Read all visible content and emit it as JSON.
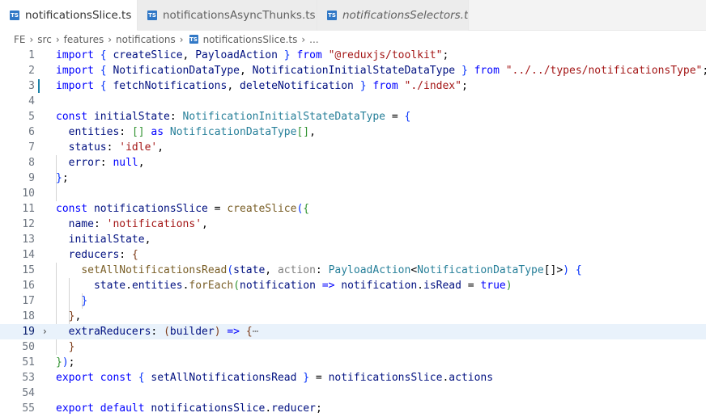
{
  "tabs": [
    {
      "label": "notificationsSlice.ts",
      "icon": "ts-file-icon",
      "active": true,
      "dirty": true,
      "italic": false
    },
    {
      "label": "notificationsAsyncThunks.ts",
      "icon": "ts-file-icon",
      "active": false,
      "dirty": true,
      "italic": false
    },
    {
      "label": "notificationsSelectors.ts",
      "icon": "ts-file-icon",
      "active": false,
      "dirty": false,
      "italic": true
    }
  ],
  "ts_icon_text": "TS",
  "breadcrumb": [
    "FE",
    "src",
    "features",
    "notifications",
    "notificationsSlice.ts",
    "..."
  ],
  "current_line": "19",
  "lines": [
    {
      "n": "1",
      "tokens": [
        [
          "k",
          "import"
        ],
        [
          "p",
          " "
        ],
        [
          "b1",
          "{"
        ],
        [
          "p",
          " "
        ],
        [
          "v",
          "createSlice"
        ],
        [
          "p",
          ", "
        ],
        [
          "v",
          "PayloadAction"
        ],
        [
          "p",
          " "
        ],
        [
          "b1",
          "}"
        ],
        [
          "p",
          " "
        ],
        [
          "k",
          "from"
        ],
        [
          "p",
          " "
        ],
        [
          "s",
          "\"@reduxjs/toolkit\""
        ],
        [
          "p",
          ";"
        ]
      ]
    },
    {
      "n": "2",
      "tokens": [
        [
          "k",
          "import"
        ],
        [
          "p",
          " "
        ],
        [
          "b1",
          "{"
        ],
        [
          "p",
          " "
        ],
        [
          "v",
          "NotificationDataType"
        ],
        [
          "p",
          ", "
        ],
        [
          "v",
          "NotificationInitialStateDataType"
        ],
        [
          "p",
          " "
        ],
        [
          "b1",
          "}"
        ],
        [
          "p",
          " "
        ],
        [
          "k",
          "from"
        ],
        [
          "p",
          " "
        ],
        [
          "s",
          "\"../../types/notificationsType\""
        ],
        [
          "p",
          ";"
        ]
      ]
    },
    {
      "n": "3",
      "tokens": [
        [
          "k",
          "import"
        ],
        [
          "p",
          " "
        ],
        [
          "b1",
          "{"
        ],
        [
          "p",
          " "
        ],
        [
          "v",
          "fetchNotifications"
        ],
        [
          "p",
          ", "
        ],
        [
          "v",
          "deleteNotification"
        ],
        [
          "p",
          " "
        ],
        [
          "b1",
          "}"
        ],
        [
          "p",
          " "
        ],
        [
          "k",
          "from"
        ],
        [
          "p",
          " "
        ],
        [
          "s",
          "\"./index\""
        ],
        [
          "p",
          ";"
        ]
      ]
    },
    {
      "n": "4",
      "tokens": []
    },
    {
      "n": "5",
      "tokens": [
        [
          "k",
          "const"
        ],
        [
          "p",
          " "
        ],
        [
          "v",
          "initialState"
        ],
        [
          "p",
          ": "
        ],
        [
          "t",
          "NotificationInitialStateDataType"
        ],
        [
          "p",
          " = "
        ],
        [
          "b1",
          "{"
        ]
      ]
    },
    {
      "n": "6",
      "tokens": [
        [
          "p",
          "  "
        ],
        [
          "v",
          "entities"
        ],
        [
          "p",
          ": "
        ],
        [
          "b2",
          "[]"
        ],
        [
          "p",
          " "
        ],
        [
          "k",
          "as"
        ],
        [
          "p",
          " "
        ],
        [
          "t",
          "NotificationDataType"
        ],
        [
          "b2",
          "[]"
        ],
        [
          "p",
          ","
        ]
      ]
    },
    {
      "n": "7",
      "tokens": [
        [
          "p",
          "  "
        ],
        [
          "v",
          "status"
        ],
        [
          "p",
          ": "
        ],
        [
          "s",
          "'idle'"
        ],
        [
          "p",
          ","
        ]
      ]
    },
    {
      "n": "8",
      "tokens": [
        [
          "p",
          "  "
        ],
        [
          "v",
          "error"
        ],
        [
          "p",
          ": "
        ],
        [
          "k",
          "null"
        ],
        [
          "p",
          ","
        ]
      ]
    },
    {
      "n": "9",
      "tokens": [
        [
          "b1",
          "}"
        ],
        [
          "p",
          ";"
        ]
      ]
    },
    {
      "n": "10",
      "tokens": []
    },
    {
      "n": "11",
      "tokens": [
        [
          "k",
          "const"
        ],
        [
          "p",
          " "
        ],
        [
          "v",
          "notificationsSlice"
        ],
        [
          "p",
          " = "
        ],
        [
          "f",
          "createSlice"
        ],
        [
          "b1",
          "("
        ],
        [
          "b2",
          "{"
        ]
      ]
    },
    {
      "n": "12",
      "tokens": [
        [
          "p",
          "  "
        ],
        [
          "v",
          "name"
        ],
        [
          "p",
          ": "
        ],
        [
          "s",
          "'notifications'"
        ],
        [
          "p",
          ","
        ]
      ]
    },
    {
      "n": "13",
      "tokens": [
        [
          "p",
          "  "
        ],
        [
          "v",
          "initialState"
        ],
        [
          "p",
          ","
        ]
      ]
    },
    {
      "n": "14",
      "tokens": [
        [
          "p",
          "  "
        ],
        [
          "v",
          "reducers"
        ],
        [
          "p",
          ": "
        ],
        [
          "b3",
          "{"
        ]
      ]
    },
    {
      "n": "15",
      "tokens": [
        [
          "p",
          "    "
        ],
        [
          "f",
          "setAllNotificationsRead"
        ],
        [
          "b1",
          "("
        ],
        [
          "v",
          "state"
        ],
        [
          "p",
          ", "
        ],
        [
          "ellip",
          "action"
        ],
        [
          "p",
          ": "
        ],
        [
          "t",
          "PayloadAction"
        ],
        [
          "p",
          "<"
        ],
        [
          "t",
          "NotificationDataType"
        ],
        [
          "p",
          "[]>"
        ],
        [
          "b1",
          ")"
        ],
        [
          "p",
          " "
        ],
        [
          "b1",
          "{"
        ]
      ]
    },
    {
      "n": "16",
      "tokens": [
        [
          "p",
          "      "
        ],
        [
          "v",
          "state"
        ],
        [
          "p",
          "."
        ],
        [
          "v",
          "entities"
        ],
        [
          "p",
          "."
        ],
        [
          "f",
          "forEach"
        ],
        [
          "b2",
          "("
        ],
        [
          "v",
          "notification"
        ],
        [
          "p",
          " "
        ],
        [
          "k",
          "=>"
        ],
        [
          "p",
          " "
        ],
        [
          "v",
          "notification"
        ],
        [
          "p",
          "."
        ],
        [
          "v",
          "isRead"
        ],
        [
          "p",
          " = "
        ],
        [
          "k",
          "true"
        ],
        [
          "b2",
          ")"
        ]
      ]
    },
    {
      "n": "17",
      "tokens": [
        [
          "p",
          "    "
        ],
        [
          "b1",
          "}"
        ]
      ]
    },
    {
      "n": "18",
      "tokens": [
        [
          "p",
          "  "
        ],
        [
          "b3",
          "}"
        ],
        [
          "p",
          ","
        ]
      ]
    },
    {
      "n": "19",
      "tokens": [
        [
          "p",
          "  "
        ],
        [
          "v",
          "extraReducers"
        ],
        [
          "p",
          ": "
        ],
        [
          "b3",
          "("
        ],
        [
          "v",
          "builder"
        ],
        [
          "b3",
          ")"
        ],
        [
          "p",
          " "
        ],
        [
          "k",
          "=>"
        ],
        [
          "p",
          " "
        ],
        [
          "b3",
          "{"
        ],
        [
          "ellip",
          "⋯"
        ]
      ]
    },
    {
      "n": "50",
      "tokens": [
        [
          "p",
          "  "
        ],
        [
          "b3",
          "}"
        ]
      ]
    },
    {
      "n": "51",
      "tokens": [
        [
          "b2",
          "}"
        ],
        [
          "b1",
          ")"
        ],
        [
          "p",
          ";"
        ]
      ]
    },
    {
      "n": "53",
      "tokens": [
        [
          "k",
          "export"
        ],
        [
          "p",
          " "
        ],
        [
          "k",
          "const"
        ],
        [
          "p",
          " "
        ],
        [
          "b1",
          "{"
        ],
        [
          "p",
          " "
        ],
        [
          "v",
          "setAllNotificationsRead"
        ],
        [
          "p",
          " "
        ],
        [
          "b1",
          "}"
        ],
        [
          "p",
          " = "
        ],
        [
          "v",
          "notificationsSlice"
        ],
        [
          "p",
          "."
        ],
        [
          "v",
          "actions"
        ]
      ]
    },
    {
      "n": "54",
      "tokens": []
    },
    {
      "n": "55",
      "tokens": [
        [
          "k",
          "export"
        ],
        [
          "p",
          " "
        ],
        [
          "k",
          "default"
        ],
        [
          "p",
          " "
        ],
        [
          "v",
          "notificationsSlice"
        ],
        [
          "p",
          "."
        ],
        [
          "v",
          "reducer"
        ],
        [
          "p",
          ";"
        ]
      ]
    }
  ],
  "colors": {
    "keyword": "#0000ff",
    "string": "#a31515",
    "variable": "#001080",
    "function": "#795e26",
    "type": "#267f99",
    "tab_dot": "#424242",
    "ts_icon": "#3178c6"
  }
}
